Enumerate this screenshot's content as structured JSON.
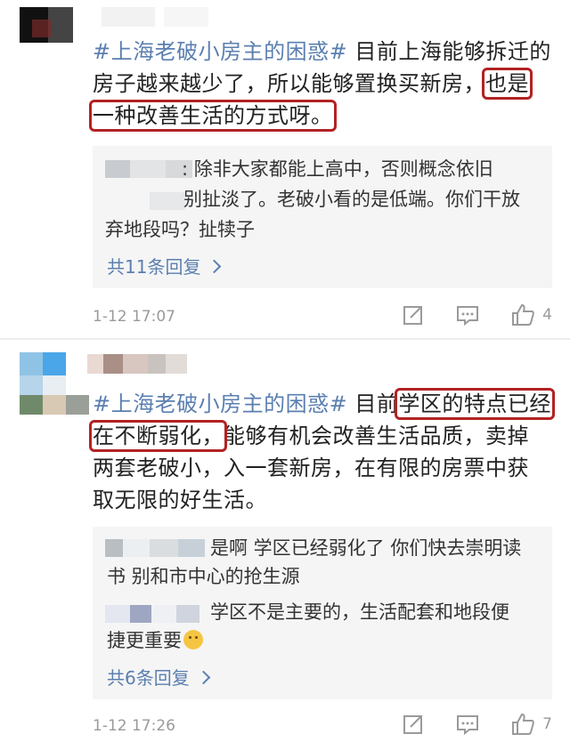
{
  "comments": [
    {
      "tag": "#上海老破小房主的困惑#",
      "lines": [
        {
          "pre": " 目前上海能够拆迁的"
        },
        {
          "pre": "房子越来越少了，所以能够置换买新房，",
          "hl": "也是"
        },
        {
          "hl": "一种改善生活的方式呀。"
        }
      ],
      "replies": [
        {
          "text1": ": 除非大家都能上高中，否则概念依旧",
          "text2": "别扯淡了。老破小看的是低端。你们干放",
          "text3": "弃地段吗？扯犊子"
        }
      ],
      "more_label": "共11条回复",
      "time": "1-12 17:07",
      "like_count": "4"
    },
    {
      "tag": "#上海老破小房主的困惑#",
      "lines": [
        {
          "pre": " 目前",
          "hl": "学区的特点已经"
        },
        {
          "hl": "在不断弱化，",
          "post": "能够有机会改善生活品质，卖掉"
        },
        {
          "pre": "两套老破小，入一套新房，在有限的房票中获"
        },
        {
          "pre": "取无限的好生活。"
        }
      ],
      "replies": [
        {
          "text1": "是啊 学区已经弱化了 你们快去崇明读",
          "text2": "书 别和市中心的抢生源"
        },
        {
          "text1": "学区不是主要的，生活配套和地段便",
          "text2": "捷更重要"
        }
      ],
      "more_label": "共6条回复",
      "time": "1-12 17:26",
      "like_count": "7"
    }
  ],
  "icons": {
    "share": "share-icon",
    "comment": "comment-icon",
    "like": "thumbs-up-icon",
    "more": "chevron-right-icon",
    "emoji": "smile-emoji-icon"
  },
  "colors": {
    "tag": "#5b7fb0",
    "highlight_box": "#b22222",
    "reply_bg": "#f5f5f5",
    "meta": "#9a9a9a"
  }
}
